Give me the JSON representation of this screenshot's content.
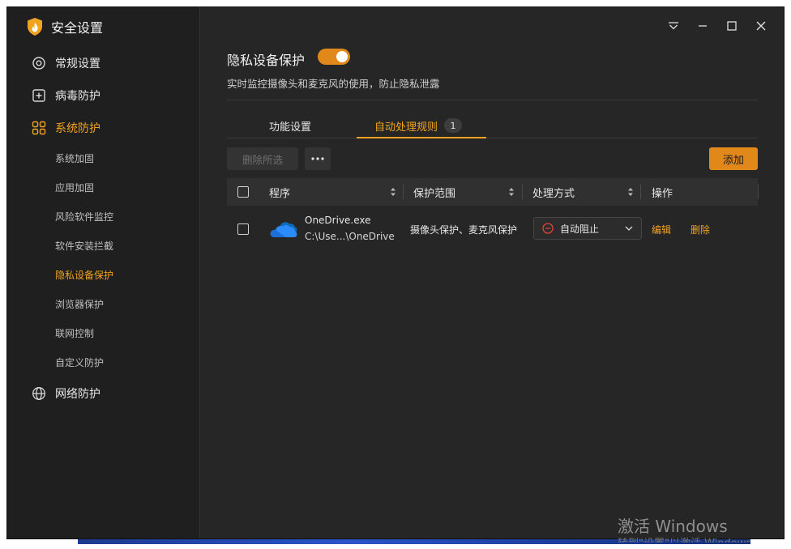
{
  "app": {
    "title": "安全设置"
  },
  "sidebar": {
    "items": [
      {
        "label": "常规设置",
        "icon": "settings-icon"
      },
      {
        "label": "病毒防护",
        "icon": "plus-square-icon"
      },
      {
        "label": "系统防护",
        "icon": "grid-icon",
        "active": true
      },
      {
        "label": "网络防护",
        "icon": "globe-icon"
      }
    ],
    "sub_items": [
      {
        "label": "系统加固"
      },
      {
        "label": "应用加固"
      },
      {
        "label": "风险软件监控"
      },
      {
        "label": "软件安装拦截"
      },
      {
        "label": "隐私设备保护",
        "active": true
      },
      {
        "label": "浏览器保护"
      },
      {
        "label": "联网控制"
      },
      {
        "label": "自定义防护"
      }
    ]
  },
  "feature": {
    "title": "隐私设备保护",
    "enabled": true,
    "description": "实时监控摄像头和麦克风的使用，防止隐私泄露"
  },
  "tabs": [
    {
      "label": "功能设置"
    },
    {
      "label": "自动处理规则",
      "badge": "1",
      "active": true
    }
  ],
  "toolbar": {
    "delete_selected": "删除所选",
    "more": "···",
    "add": "添加"
  },
  "table": {
    "headers": [
      "程序",
      "保护范围",
      "处理方式",
      "操作"
    ],
    "rows": [
      {
        "app_name": "OneDrive.exe",
        "app_path": "C:\\Use...\\OneDrive",
        "scope": "摄像头保护、麦克风保护",
        "action": "自动阻止",
        "edit": "编辑",
        "delete": "删除"
      }
    ]
  },
  "watermark": {
    "title": "激活 Windows",
    "subtitle": "转到\"设置\"以激活 Windows。"
  },
  "colors": {
    "accent": "#f0a321",
    "toggle": "#e0891a",
    "window_bg": "#262626",
    "sidebar_bg": "#1f1f1f",
    "block_red": "#e0443a",
    "onedrive_blue": "#1e88e5"
  }
}
